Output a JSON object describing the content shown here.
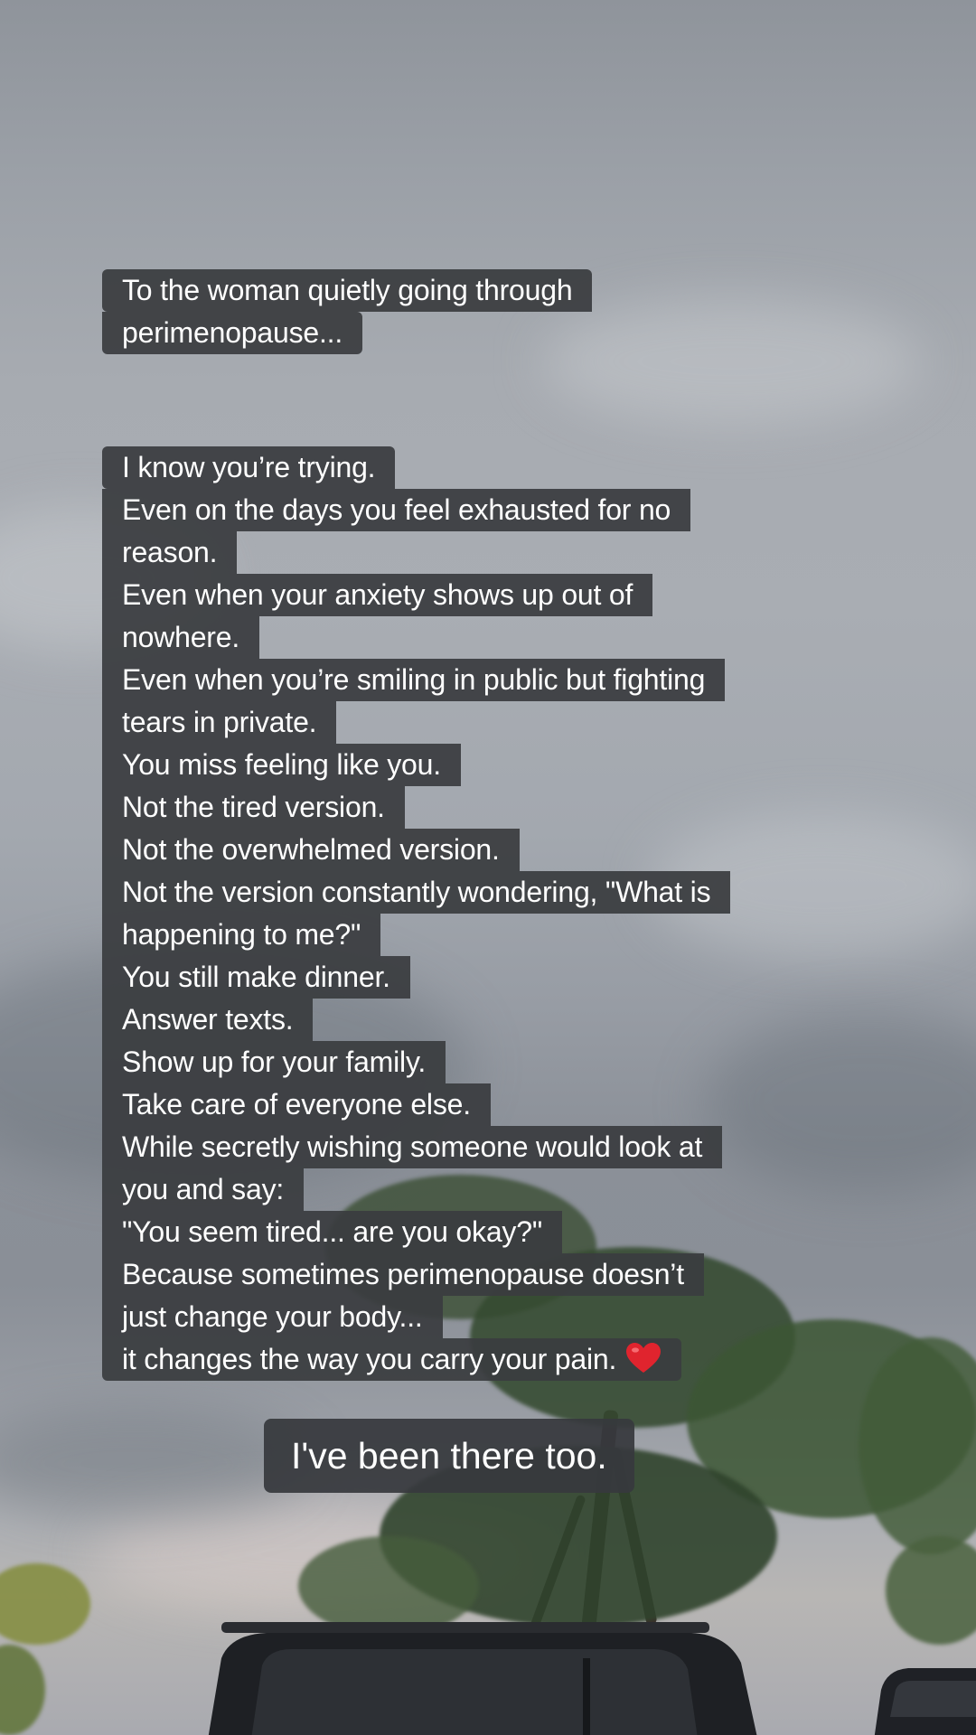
{
  "caption": {
    "intro_lines": [
      "To the woman quietly going through",
      "perimenopause..."
    ],
    "body_lines": [
      "I know you’re trying.",
      "Even on the days you feel exhausted for no",
      "reason.",
      "Even when your anxiety shows up out of",
      "nowhere.",
      "Even when you’re smiling in public but fighting",
      "tears in private.",
      "You miss feeling like you.",
      "Not the tired version.",
      "Not the overwhelmed version.",
      "Not the version constantly wondering, \"What is",
      "happening to me?\"",
      "You still make dinner.",
      "Answer texts.",
      "Show up for your family.",
      "Take care of everyone else.",
      "While secretly wishing someone would look at",
      "you and say:",
      "\"You seem tired... are you okay?\"",
      "Because sometimes perimenopause doesn’t",
      "just change your body...",
      "it changes the way you carry your pain."
    ],
    "heart_icon": "red-heart-icon",
    "tagline": "I've been there too."
  },
  "colors": {
    "caption_background": "#3a3c40",
    "caption_text": "#ffffff",
    "heart": "#e0242e"
  },
  "background": {
    "scene": "overcast-sky-with-tree-and-parked-vehicles"
  }
}
